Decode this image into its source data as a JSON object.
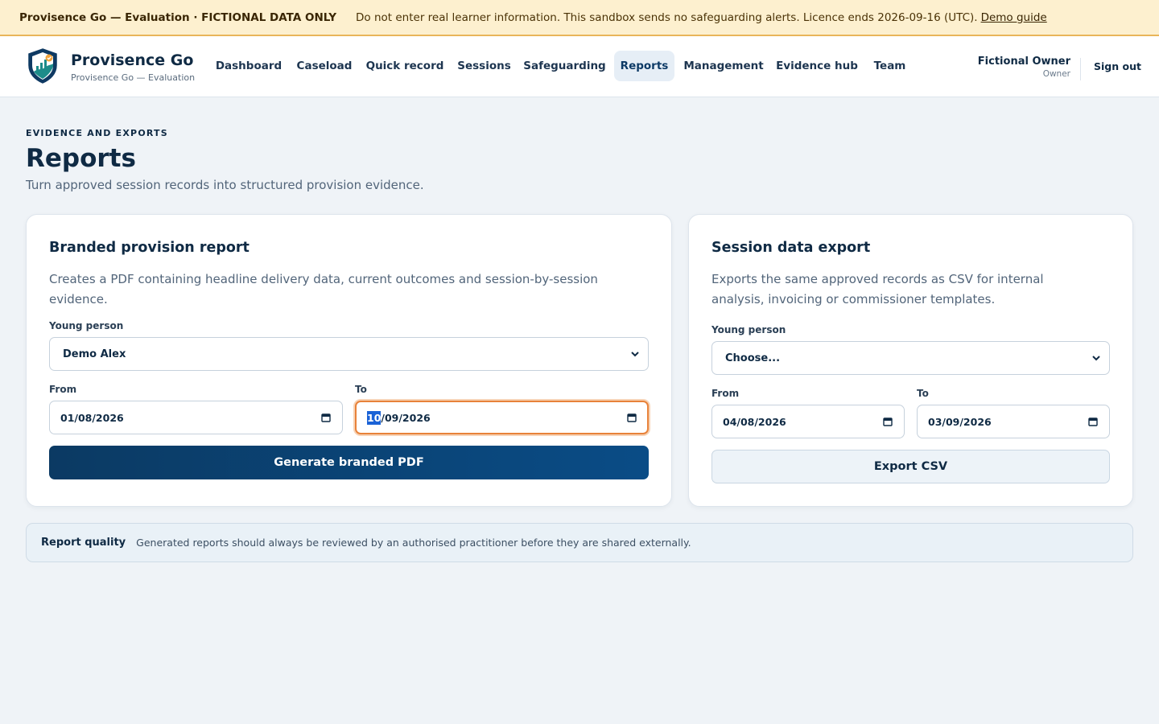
{
  "banner": {
    "title": "Provisence Go — Evaluation · FICTIONAL DATA ONLY",
    "message": "Do not enter real learner information. This sandbox sends no safeguarding alerts. Licence ends 2026-09-16 (UTC).",
    "link": "Demo guide"
  },
  "header": {
    "brand_name": "Provisence Go",
    "brand_sub": "Provisence Go — Evaluation",
    "nav": [
      {
        "label": "Dashboard"
      },
      {
        "label": "Caseload"
      },
      {
        "label": "Quick record"
      },
      {
        "label": "Sessions"
      },
      {
        "label": "Safeguarding"
      },
      {
        "label": "Reports",
        "active": true
      },
      {
        "label": "Management"
      },
      {
        "label": "Evidence hub"
      },
      {
        "label": "Team"
      }
    ],
    "user_name": "Fictional Owner",
    "user_role": "Owner",
    "sign_out": "Sign out"
  },
  "page": {
    "eyebrow": "EVIDENCE AND EXPORTS",
    "title": "Reports",
    "description": "Turn approved session records into structured provision evidence."
  },
  "provision_report": {
    "title": "Branded provision report",
    "description": "Creates a PDF containing headline delivery data, current outcomes and session-by-session evidence.",
    "young_person_label": "Young person",
    "young_person_value": "Demo Alex",
    "from_label": "From",
    "from_value": "01/08/2026",
    "to_label": "To",
    "to_value_selected": "10",
    "to_value_rest": "/09/2026",
    "button": "Generate branded PDF"
  },
  "session_export": {
    "title": "Session data export",
    "description": "Exports the same approved records as CSV for internal analysis, invoicing or commissioner templates.",
    "young_person_label": "Young person",
    "young_person_value": "Choose...",
    "from_label": "From",
    "from_value": "04/08/2026",
    "to_label": "To",
    "to_value": "03/09/2026",
    "button": "Export CSV"
  },
  "quality": {
    "label": "Report quality",
    "text": "Generated reports should always be reviewed by an authorised practitioner before they are shared externally."
  },
  "colors": {
    "banner_bg": "#fdf0cf",
    "primary": "#0b3a63",
    "focus_ring": "#e8823a",
    "page_bg": "#eff3f7"
  },
  "icons": {
    "logo": "shield-logo-icon",
    "select": "chevron-down-icon",
    "date": "calendar-icon"
  }
}
